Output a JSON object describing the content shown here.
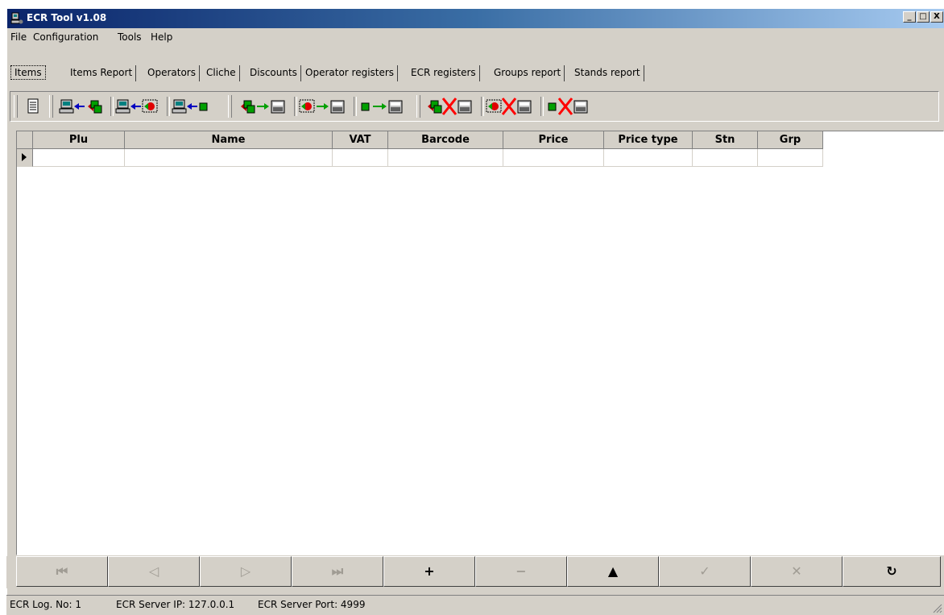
{
  "window": {
    "title": "ECR Tool v1.08",
    "minimize_label": "_",
    "maximize_label": "□",
    "close_label": "X"
  },
  "menu": [
    "File",
    "Configuration",
    "Tools",
    "Help"
  ],
  "tabs": [
    "Items",
    "Items Report",
    "Operators",
    "Cliche",
    "Discounts",
    "Operator registers",
    "ECR registers",
    "Groups report",
    "Stands report"
  ],
  "active_tab": "Items",
  "toolbar": {
    "buttons": [
      {
        "name": "item-properties",
        "icon": "document-icon"
      },
      {
        "name": "read-all-items",
        "icon": "read-all-icon"
      },
      {
        "name": "read-selected-items",
        "icon": "read-selected-icon"
      },
      {
        "name": "read-current-item",
        "icon": "read-current-icon"
      },
      {
        "name": "write-all-items",
        "icon": "write-all-icon"
      },
      {
        "name": "write-selected-items",
        "icon": "write-selected-icon"
      },
      {
        "name": "write-current-item",
        "icon": "write-current-icon"
      },
      {
        "name": "delete-all-items",
        "icon": "delete-all-icon"
      },
      {
        "name": "delete-selected-items",
        "icon": "delete-selected-icon"
      },
      {
        "name": "delete-current-item",
        "icon": "delete-current-icon"
      }
    ]
  },
  "grid": {
    "columns": [
      "Plu",
      "Name",
      "VAT",
      "Barcode",
      "Price",
      "Price type",
      "Stn",
      "Grp"
    ],
    "rows": [
      [
        "",
        "",
        "",
        "",
        "",
        "",
        "",
        ""
      ]
    ]
  },
  "navigator": [
    {
      "name": "first",
      "label": "⏮",
      "enabled": false
    },
    {
      "name": "prior",
      "label": "◁",
      "enabled": false
    },
    {
      "name": "next",
      "label": "▷",
      "enabled": false
    },
    {
      "name": "last",
      "label": "⏭",
      "enabled": false
    },
    {
      "name": "insert",
      "label": "+",
      "enabled": true
    },
    {
      "name": "delete",
      "label": "−",
      "enabled": false
    },
    {
      "name": "edit",
      "label": "▲",
      "enabled": true
    },
    {
      "name": "post",
      "label": "✓",
      "enabled": false
    },
    {
      "name": "cancel",
      "label": "✕",
      "enabled": false
    },
    {
      "name": "refresh",
      "label": "↻",
      "enabled": true
    }
  ],
  "status": {
    "log_no": "ECR Log. No: 1",
    "server_ip": "ECR Server IP: 127.0.0.1",
    "server_port": "ECR Server Port: 4999"
  }
}
